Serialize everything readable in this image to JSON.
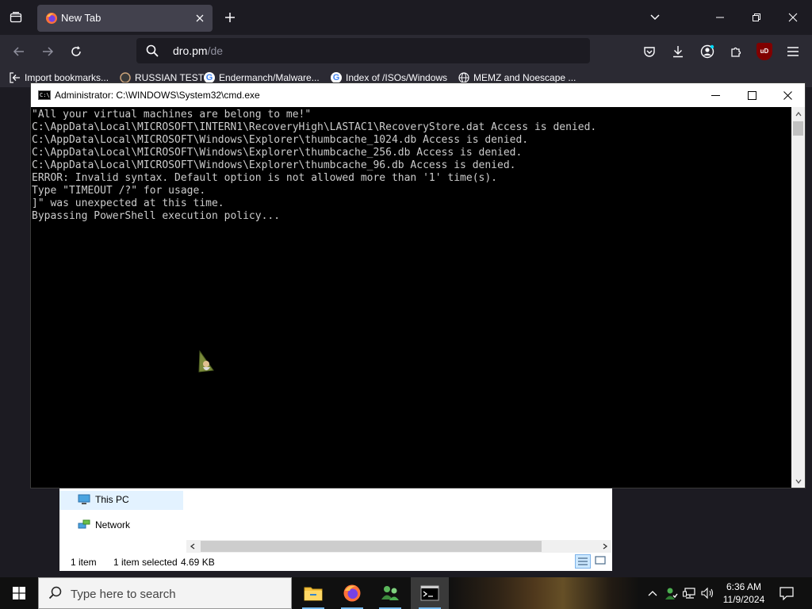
{
  "browser": {
    "tab": {
      "title": "New Tab"
    },
    "urlbar": {
      "host": "dro.pm",
      "path": "/de"
    },
    "extension_badge": "uD",
    "bookmarks": [
      {
        "label": "Import bookmarks...",
        "icon": "import-icon"
      },
      {
        "label": "RUSSIAN TEST",
        "icon": "site-icon"
      },
      {
        "label": "Endermanch/Malware...",
        "icon": "google-icon"
      },
      {
        "label": "Index of /ISOs/Windows",
        "icon": "google-icon"
      },
      {
        "label": "MEMZ and Noescape ...",
        "icon": "globe-icon"
      }
    ],
    "google_glyph": "G"
  },
  "cmd": {
    "title": "Administrator: C:\\WINDOWS\\System32\\cmd.exe",
    "icon_glyph": "C:\\",
    "lines": [
      "\"All your virtual machines are belong to me!\"",
      "C:\\AppData\\Local\\MICROSOFT\\INTERN1\\RecoveryHigh\\LASTAC1\\RecoveryStore.dat Access is denied.",
      "C:\\AppData\\Local\\MICROSOFT\\Windows\\Explorer\\thumbcache_1024.db Access is denied.",
      "C:\\AppData\\Local\\MICROSOFT\\Windows\\Explorer\\thumbcache_256.db Access is denied.",
      "C:\\AppData\\Local\\MICROSOFT\\Windows\\Explorer\\thumbcache_96.db Access is denied.",
      "ERROR: Invalid syntax. Default option is not allowed more than '1' time(s).",
      "Type \"TIMEOUT /?\" for usage.",
      "]\" was unexpected at this time.",
      "Bypassing PowerShell execution policy..."
    ]
  },
  "explorer": {
    "nav_items": [
      {
        "label": "This PC",
        "icon": "this-pc-icon"
      },
      {
        "label": "Network",
        "icon": "network-icon"
      }
    ],
    "status": {
      "count": "1 item",
      "selected": "1 item selected",
      "size": "4.69 KB"
    }
  },
  "taskbar": {
    "search_placeholder": "Type here to search",
    "apps": [
      "file-explorer",
      "firefox",
      "users-app",
      "command-prompt"
    ],
    "time": "6:36 AM",
    "date": "11/9/2024"
  },
  "colors": {
    "firefox_dark": "#1c1b22",
    "firefox_toolbar": "#2b2a33",
    "console_text": "#cccccc",
    "taskbar": "#101010"
  }
}
